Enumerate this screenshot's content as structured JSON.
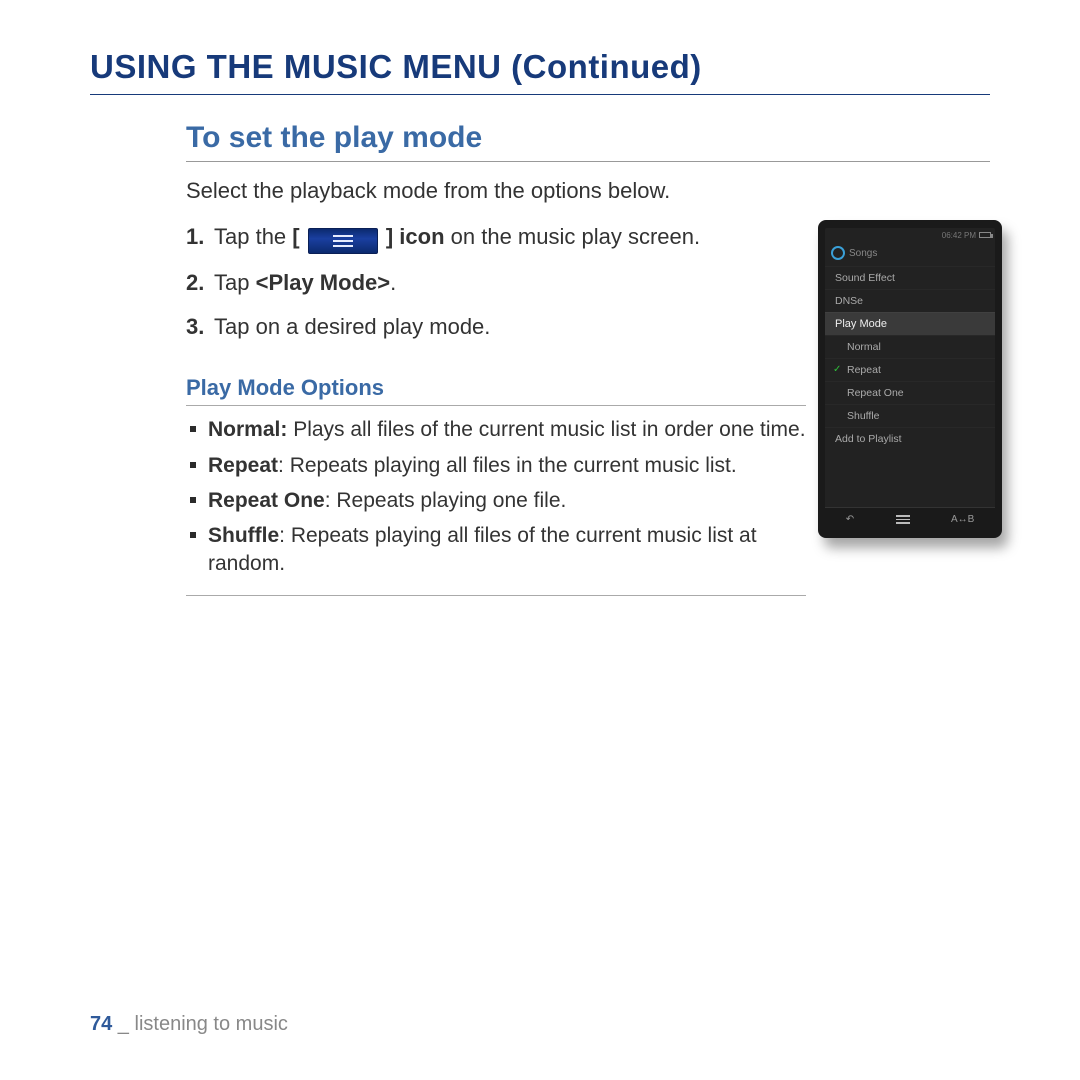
{
  "colors": {
    "heading": "#173a7a",
    "subheading": "#3a6aa5",
    "accent_green": "#2fbf3a"
  },
  "h1": "USING THE MUSIC MENU (Continued)",
  "h2": "To set the play mode",
  "intro": "Select the playback mode from the options below.",
  "steps": {
    "s1_pre": "Tap the ",
    "s1_bracket_open": "[",
    "s1_bracket_close": "]",
    "s1_icon_word": " icon",
    "s1_post": " on the music play screen.",
    "s2_pre": "Tap ",
    "s2_bold": "<Play Mode>",
    "s2_post": ".",
    "s3": "Tap on a desired play mode."
  },
  "h3": "Play Mode Options",
  "options": [
    {
      "term": "Normal:",
      "desc": " Plays all files of the current music list in order one time."
    },
    {
      "term": "Repeat",
      "desc": ": Repeats playing all files in the current music list."
    },
    {
      "term": "Repeat One",
      "desc": ": Repeats playing one file."
    },
    {
      "term": "Shuffle",
      "desc": ": Repeats playing all files of the current music list at random."
    }
  ],
  "device": {
    "time": "06:42 PM",
    "top_label": "Songs",
    "rows": {
      "sound_effect": "Sound Effect",
      "dnse": "DNSe",
      "play_mode": "Play Mode",
      "normal": "Normal",
      "repeat": "Repeat",
      "repeat_one": "Repeat One",
      "shuffle": "Shuffle",
      "add_playlist": "Add to Playlist"
    },
    "nav": {
      "back": "↶",
      "ab": "A↔B"
    }
  },
  "footer": {
    "page": "74",
    "sep": " _ ",
    "section": "listening to music"
  }
}
